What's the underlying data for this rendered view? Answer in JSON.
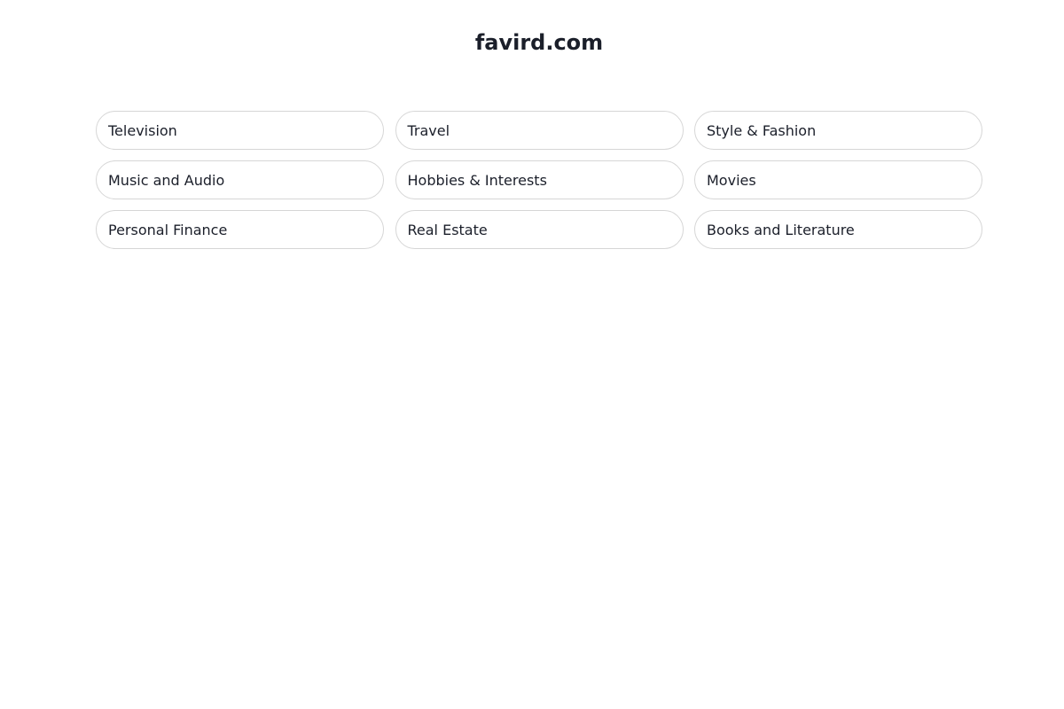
{
  "header": {
    "title": "favird.com"
  },
  "categories": [
    {
      "label": "Television"
    },
    {
      "label": "Travel"
    },
    {
      "label": "Style & Fashion"
    },
    {
      "label": "Music and Audio"
    },
    {
      "label": "Hobbies & Interests"
    },
    {
      "label": "Movies"
    },
    {
      "label": "Personal Finance"
    },
    {
      "label": "Real Estate"
    },
    {
      "label": "Books and Literature"
    }
  ],
  "colors": {
    "text": "#1b1f2a",
    "border": "#d6d6d6",
    "background": "#ffffff"
  }
}
